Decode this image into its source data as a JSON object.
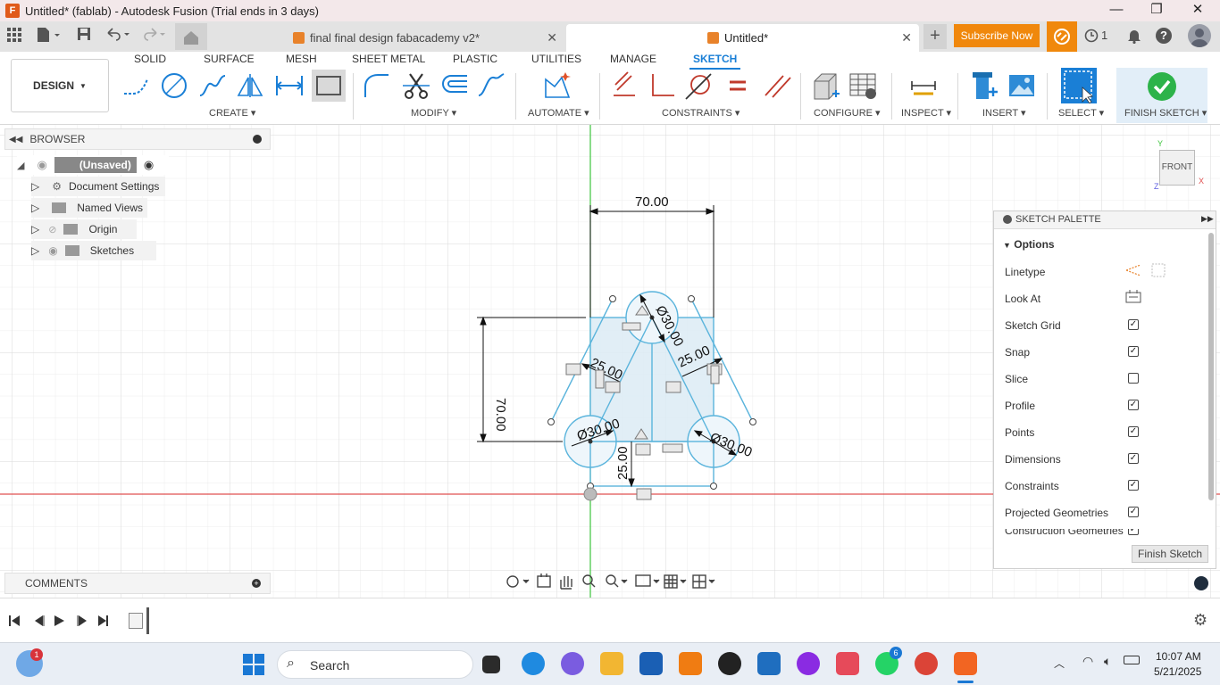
{
  "window": {
    "title": "Untitled* (fablab) - Autodesk Fusion (Trial ends in 3 days)",
    "minimize": "—",
    "maximize": "❐",
    "close": "✕"
  },
  "tabs": {
    "doc1": "final final design fabacademy v2*",
    "doc2": "Untitled*",
    "subscribe": "Subscribe Now",
    "jobs_count": "1"
  },
  "ribbon": {
    "workspace": "DESIGN",
    "tabs": [
      "SOLID",
      "SURFACE",
      "MESH",
      "SHEET METAL",
      "PLASTIC",
      "UTILITIES",
      "MANAGE",
      "SKETCH"
    ],
    "groups": {
      "create": "CREATE",
      "modify": "MODIFY",
      "automate": "AUTOMATE",
      "constraints": "CONSTRAINTS",
      "configure": "CONFIGURE",
      "inspect": "INSPECT",
      "insert": "INSERT",
      "select": "SELECT",
      "finish": "FINISH SKETCH"
    }
  },
  "browser": {
    "title": "BROWSER",
    "root": "(Unsaved)",
    "items": [
      "Document Settings",
      "Named Views",
      "Origin",
      "Sketches"
    ]
  },
  "comments": {
    "title": "COMMENTS"
  },
  "sketch": {
    "dim_top": "70.00",
    "dim_left": "70.00",
    "dim_left_slant": "25.00",
    "dim_right_slant": "25.00",
    "dim_bottom": "25.00",
    "dia_top": "Ø30.00",
    "dia_left": "Ø30.00",
    "dia_right": "Ø30.00"
  },
  "viewcube": {
    "face": "FRONT",
    "axis_y": "Y",
    "axis_x": "X",
    "axis_z": "Z"
  },
  "palette": {
    "title": "SKETCH PALETTE",
    "section": "Options",
    "rows": [
      {
        "label": "Linetype",
        "type": "icons"
      },
      {
        "label": "Look At",
        "type": "icon"
      },
      {
        "label": "Sketch Grid",
        "checked": true
      },
      {
        "label": "Snap",
        "checked": true
      },
      {
        "label": "Slice",
        "checked": false
      },
      {
        "label": "Profile",
        "checked": true
      },
      {
        "label": "Points",
        "checked": true
      },
      {
        "label": "Dimensions",
        "checked": true
      },
      {
        "label": "Constraints",
        "checked": true
      },
      {
        "label": "Projected Geometries",
        "checked": true
      },
      {
        "label": "Construction Geometries",
        "checked": true
      }
    ],
    "finish_button": "Finish Sketch"
  },
  "taskbar": {
    "search_placeholder": "Search",
    "time": "10:07 AM",
    "date": "5/21/2025",
    "weather_badge": "1",
    "whatsapp_badge": "6"
  },
  "colors": {
    "accent": "#1a7fd6",
    "sketch_line": "#5ab4dc",
    "profile_fill": "#dcebf5",
    "subscribe": "#f0880c",
    "finish_check": "#2db34a"
  }
}
